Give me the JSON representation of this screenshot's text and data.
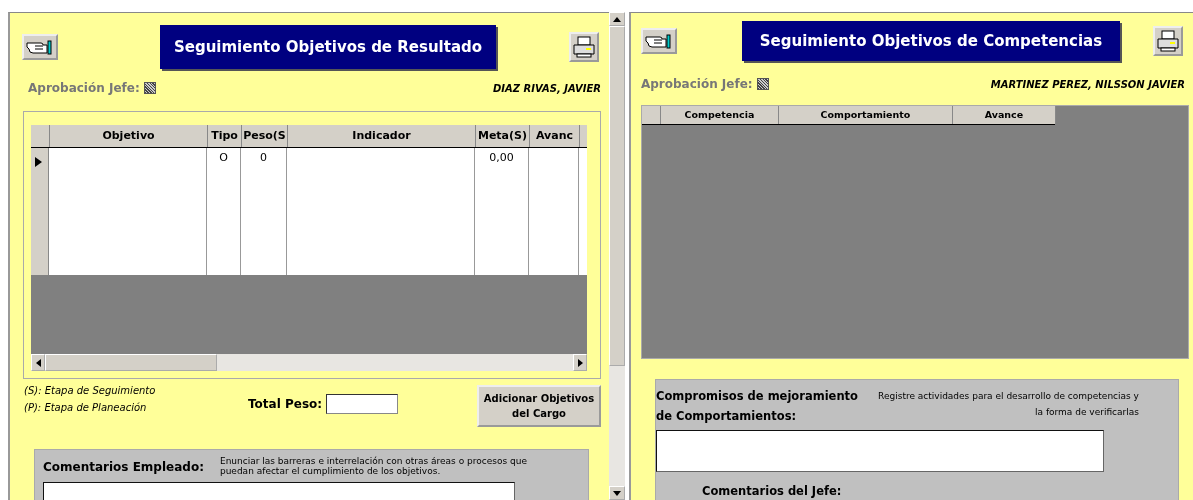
{
  "results_panel": {
    "title": "Seguimiento Objetivos de Resultado",
    "approval": {
      "label": "Aprobación Jefe:",
      "disabled": true
    },
    "employee_name": "DIAZ RIVAS, JAVIER",
    "grid": {
      "columns": [
        "Objetivo",
        "Tipo",
        "Peso(S",
        "Indicador",
        "Meta(S)",
        "Avanc"
      ],
      "rows": [
        {
          "current": true,
          "cells": [
            "",
            "O",
            "0",
            "",
            "0,00",
            ""
          ]
        }
      ]
    },
    "legend": [
      "(S): Etapa de Seguimiento",
      "(P): Etapa de Planeación"
    ],
    "total_label": "Total Peso:",
    "add_button": "Adicionar Objetivos del Cargo",
    "comments": {
      "label": "Comentarios Empleado:",
      "hint": "Enunciar las barreras e interrelación con otras áreas o procesos que puedan afectar el cumplimiento de los objetivos."
    }
  },
  "competencies_panel": {
    "title": "Seguimiento Objetivos de Competencias",
    "approval": {
      "label": "Aprobación Jefe:",
      "disabled": true
    },
    "employee_name": "MARTINEZ PEREZ, NILSSON JAVIER",
    "grid": {
      "columns": [
        "Competencia",
        "Comportamiento",
        "Avance"
      ]
    },
    "commitments": {
      "label": "Compromisos de mejoramiento de Comportamientos:",
      "hint": "Registre actividades para el desarrollo de competencias y la forma de verificarlas"
    },
    "boss_comments_label": "Comentarios del Jefe:"
  }
}
